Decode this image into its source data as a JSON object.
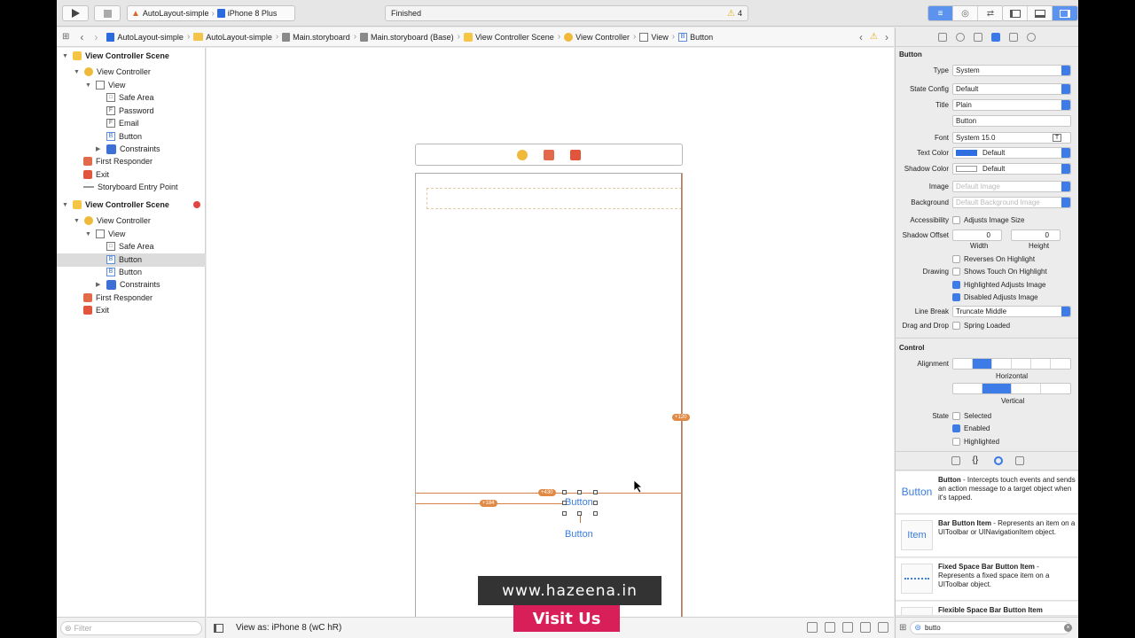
{
  "toolbar": {
    "scheme": "AutoLayout-simple",
    "device": "iPhone 8 Plus",
    "status": "Finished",
    "warnings": "4"
  },
  "jumpbar": {
    "items": [
      "AutoLayout-simple",
      "AutoLayout-simple",
      "Main.storyboard",
      "Main.storyboard (Base)",
      "View Controller Scene",
      "View Controller",
      "View",
      "Button"
    ]
  },
  "outline": {
    "rows": [
      {
        "label": "View Controller Scene",
        "bold": true
      },
      {
        "label": "View Controller"
      },
      {
        "label": "View"
      },
      {
        "label": "Safe Area"
      },
      {
        "label": "Password"
      },
      {
        "label": "Email"
      },
      {
        "label": "Button"
      },
      {
        "label": "Constraints"
      },
      {
        "label": "First Responder"
      },
      {
        "label": "Exit"
      },
      {
        "label": "Storyboard Entry Point"
      },
      {
        "label": "View Controller Scene",
        "bold": true
      },
      {
        "label": "View Controller"
      },
      {
        "label": "View"
      },
      {
        "label": "Safe Area"
      },
      {
        "label": "Button",
        "selected": true
      },
      {
        "label": "Button"
      },
      {
        "label": "Constraints"
      },
      {
        "label": "First Responder"
      },
      {
        "label": "Exit"
      }
    ],
    "filter_placeholder": "Filter"
  },
  "canvas": {
    "button_selected": "Button",
    "button_second": "Button",
    "constraint_badges": [
      "+430",
      "+184",
      "+120"
    ],
    "view_as": "View as: iPhone 8 (wC hR)"
  },
  "watermark": {
    "url": "www.hazeena.in",
    "cta": "Visit Us"
  },
  "inspector": {
    "section_button": "Button",
    "type_label": "Type",
    "type_value": "System",
    "state_config_label": "State Config",
    "state_config_value": "Default",
    "title_label": "Title",
    "title_value": "Plain",
    "title_text": "Button",
    "font_label": "Font",
    "font_value": "System 15.0",
    "text_color_label": "Text Color",
    "text_color_value": "Default",
    "shadow_color_label": "Shadow Color",
    "shadow_color_value": "Default",
    "image_label": "Image",
    "image_placeholder": "Default Image",
    "background_label": "Background",
    "background_placeholder": "Default Background Image",
    "accessibility_label": "Accessibility",
    "accessibility_value": "Adjusts Image Size",
    "shadow_offset_label": "Shadow Offset",
    "shadow_w": "0",
    "shadow_h": "0",
    "width_caption": "Width",
    "height_caption": "Height",
    "reverses": "Reverses On Highlight",
    "drawing_label": "Drawing",
    "shows_touch": "Shows Touch On Highlight",
    "highlighted_adjusts": "Highlighted Adjusts Image",
    "disabled_adjusts": "Disabled Adjusts Image",
    "line_break_label": "Line Break",
    "line_break_value": "Truncate Middle",
    "drag_drop_label": "Drag and Drop",
    "spring_loaded": "Spring Loaded",
    "section_control": "Control",
    "alignment_label": "Alignment",
    "horizontal_caption": "Horizontal",
    "vertical_caption": "Vertical",
    "state_label": "State",
    "selected": "Selected",
    "enabled": "Enabled",
    "highlighted": "Highlighted"
  },
  "library": {
    "items": [
      {
        "thumb": "Button",
        "title": "Button",
        "desc": " - Intercepts touch events and sends an action message to a target object when it's tapped."
      },
      {
        "thumb": "Item",
        "title": "Bar Button Item",
        "desc": " - Represents an item on a UIToolbar or UINavigationItem object."
      },
      {
        "thumb": "",
        "title": "Fixed Space Bar Button Item",
        "desc": " - Represents a fixed space item on a UIToolbar object."
      },
      {
        "thumb": "",
        "title": "Flexible Space Bar Button Item",
        "desc": ""
      }
    ],
    "search_value": "butto"
  }
}
